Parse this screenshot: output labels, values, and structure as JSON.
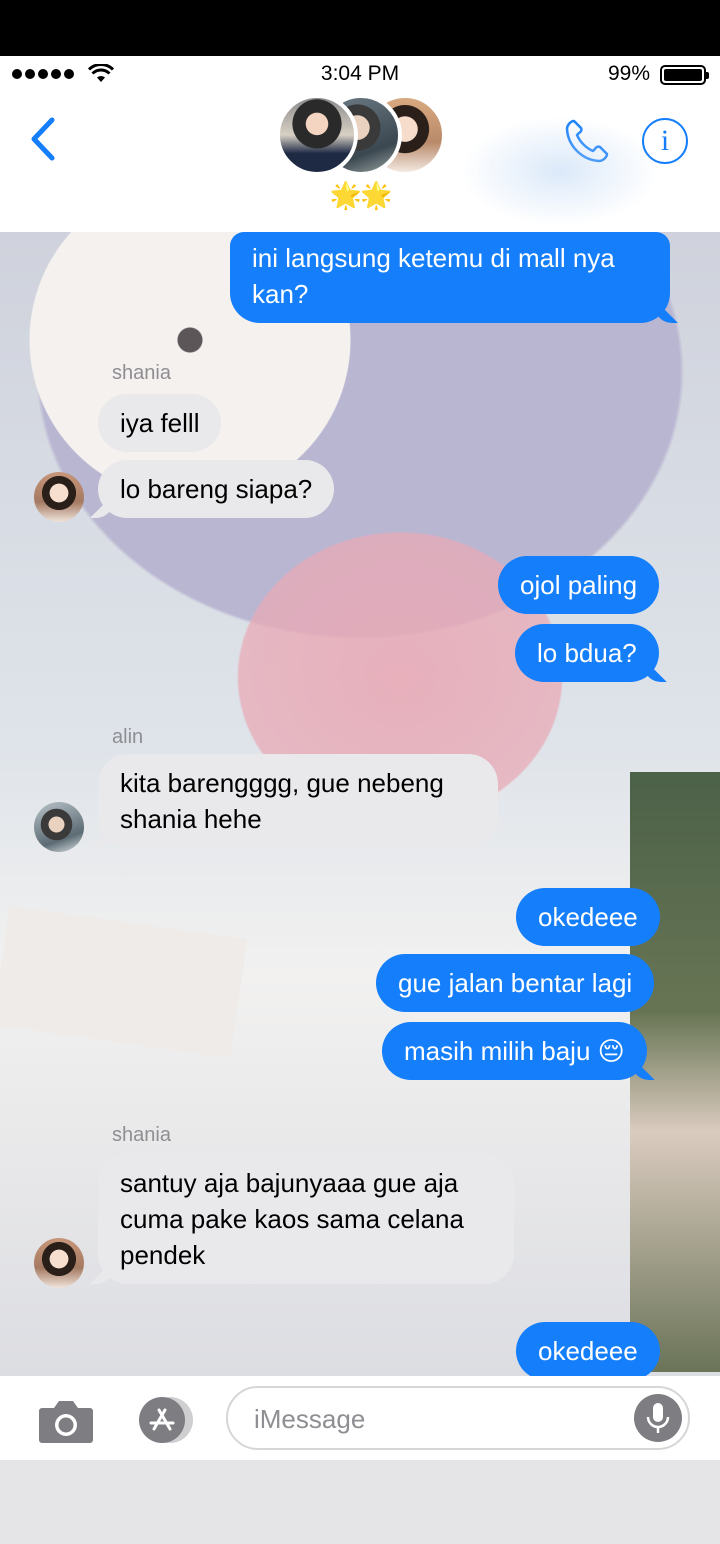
{
  "status_bar": {
    "time": "3:04 PM",
    "battery": "99%",
    "battery_level": 0.99
  },
  "header": {
    "stars": "🌟🌟",
    "accent_color": "#147efb"
  },
  "messages": [
    {
      "text_lines": [
        "ini langsung ketemu di mall nya",
        "kan?"
      ],
      "direction": "out"
    },
    {
      "sender": "shania",
      "text_lines": [
        "iya felll"
      ],
      "direction": "in"
    },
    {
      "text_lines": [
        "lo bareng siapa?"
      ],
      "direction": "in"
    },
    {
      "text_lines": [
        "ojol paling"
      ],
      "direction": "out"
    },
    {
      "text_lines": [
        "lo bdua?"
      ],
      "direction": "out"
    },
    {
      "sender": "alin",
      "text_lines": [
        "kita barengggg, gue nebeng",
        "shania hehe"
      ],
      "direction": "in"
    },
    {
      "text_lines": [
        "okedeee"
      ],
      "direction": "out"
    },
    {
      "text_lines": [
        "gue jalan bentar lagi"
      ],
      "direction": "out"
    },
    {
      "text_lines": [
        "masih milih baju 😔"
      ],
      "direction": "out"
    },
    {
      "sender": "shania",
      "text_lines": [
        "santuy aja bajunyaaa gue aja",
        "cuma pake kaos sama celana",
        "pendek"
      ],
      "direction": "in"
    },
    {
      "text_lines": [
        "okedeee"
      ],
      "direction": "out"
    }
  ],
  "input_bar": {
    "placeholder": "iMessage"
  },
  "icons": [
    "back-chevron-icon",
    "phone-icon",
    "info-icon",
    "camera-icon",
    "app-store-icon",
    "microphone-icon",
    "wifi-icon",
    "battery-icon"
  ]
}
